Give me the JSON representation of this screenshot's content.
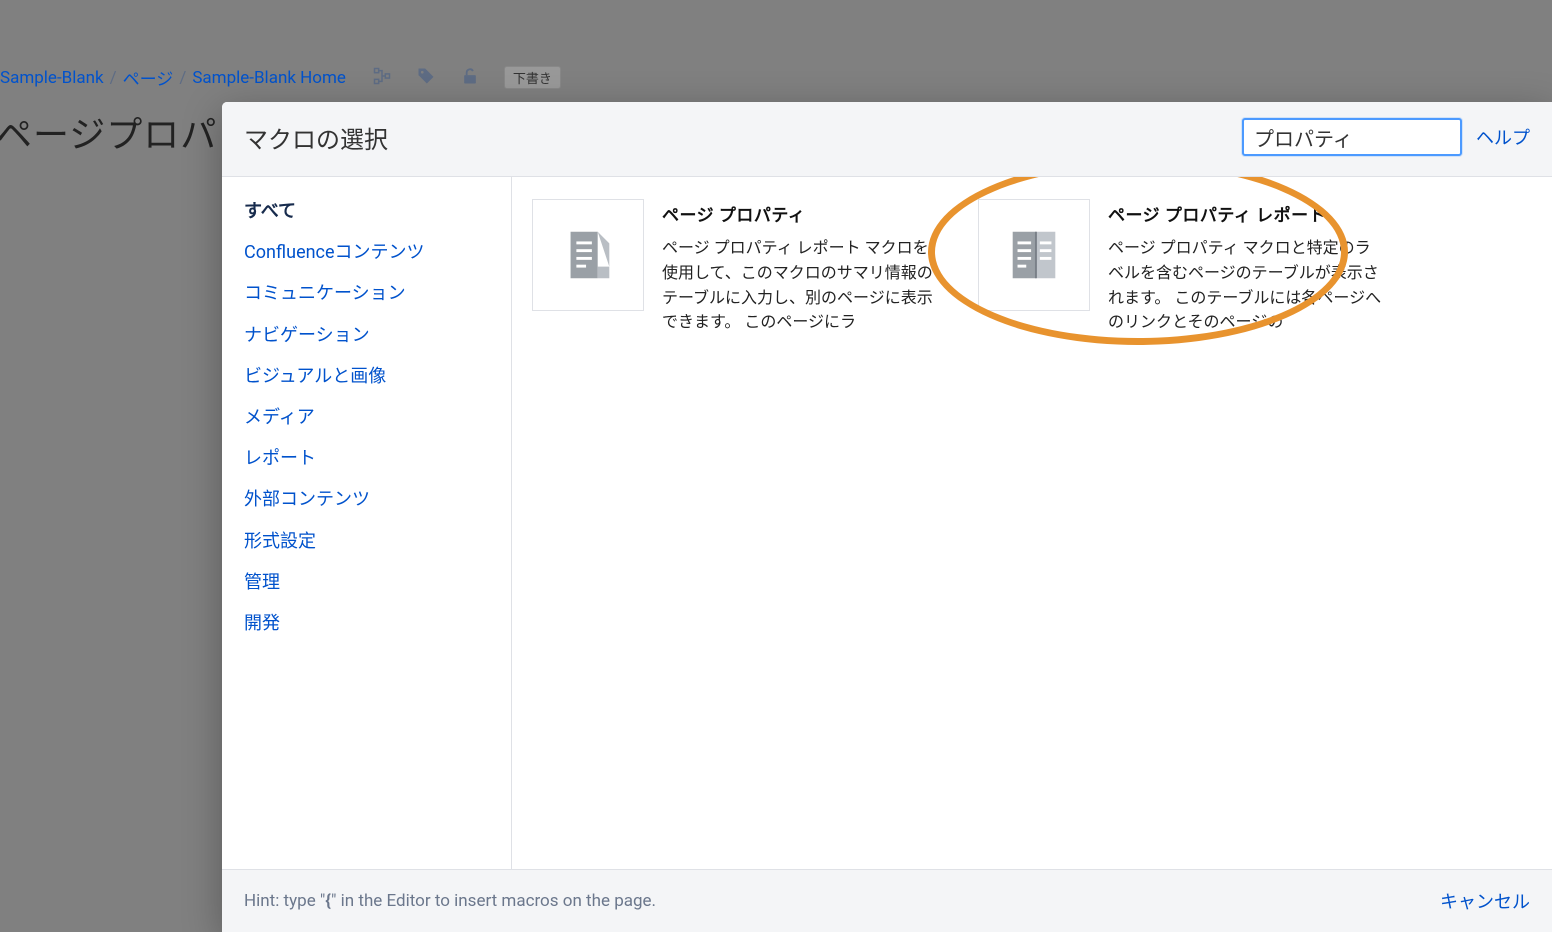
{
  "breadcrumbs": {
    "item0": "Sample-Blank",
    "item1": "ページ",
    "item2": "Sample-Blank Home",
    "sep": "/"
  },
  "draft_label": "下書き",
  "page_title_fragment": "ページプロパ",
  "modal": {
    "title": "マクロの選択",
    "search_value": "プロパティ",
    "help_label": "ヘルプ",
    "cancel_label": "キャンセル",
    "hint_prefix": "Hint: type \"",
    "hint_key": "{",
    "hint_suffix": "\" in the Editor to insert macros on the page."
  },
  "categories": [
    {
      "label": "すべて",
      "selected": true
    },
    {
      "label": "Confluenceコンテンツ"
    },
    {
      "label": "コミュニケーション"
    },
    {
      "label": "ナビゲーション"
    },
    {
      "label": "ビジュアルと画像"
    },
    {
      "label": "メディア"
    },
    {
      "label": "レポート"
    },
    {
      "label": "外部コンテンツ"
    },
    {
      "label": "形式設定"
    },
    {
      "label": "管理"
    },
    {
      "label": "開発"
    }
  ],
  "macros": [
    {
      "title": "ページ プロパティ",
      "desc": "ページ プロパティ レポート マクロを使用して、このマクロのサマリ情報のテーブルに入力し、別のページに表示できます。 このページにラ"
    },
    {
      "title": "ページ プロパティ レポート",
      "desc": "ページ プロパティ マクロと特定のラベルを含むページのテーブルが表示されます。 このテーブルには各ページへのリンクとそのページの"
    }
  ]
}
